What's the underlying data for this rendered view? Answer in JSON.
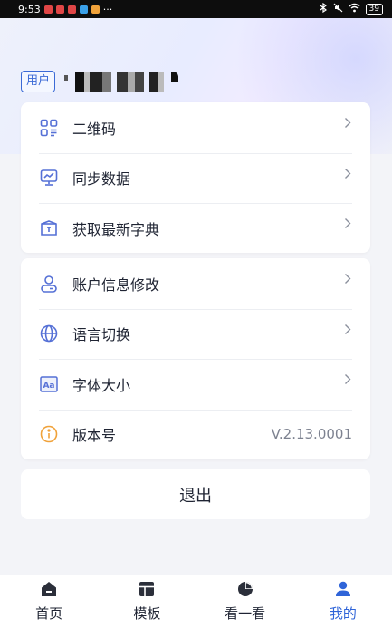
{
  "status_bar": {
    "time": "9:53",
    "battery": "39"
  },
  "user": {
    "tag": "用户"
  },
  "menu_group1": [
    {
      "label": "二维码",
      "icon": "qrcode-icon"
    },
    {
      "label": "同步数据",
      "icon": "sync-monitor-icon"
    },
    {
      "label": "获取最新字典",
      "icon": "dictionary-box-icon"
    }
  ],
  "menu_group2": [
    {
      "label": "账户信息修改",
      "icon": "user-edit-icon"
    },
    {
      "label": "语言切换",
      "icon": "globe-icon"
    },
    {
      "label": "字体大小",
      "icon": "font-size-icon"
    },
    {
      "label": "版本号",
      "icon": "info-icon",
      "value": "V.2.13.0001"
    }
  ],
  "logout_label": "退出",
  "tabs": [
    {
      "label": "首页",
      "icon": "home-icon",
      "active": false
    },
    {
      "label": "模板",
      "icon": "template-icon",
      "active": false
    },
    {
      "label": "看一看",
      "icon": "pie-chart-icon",
      "active": false
    },
    {
      "label": "我的",
      "icon": "profile-icon",
      "active": true
    }
  ],
  "colors": {
    "accent": "#2f64d8",
    "icon_blue": "#5570d6",
    "info_orange": "#f0a23a"
  }
}
